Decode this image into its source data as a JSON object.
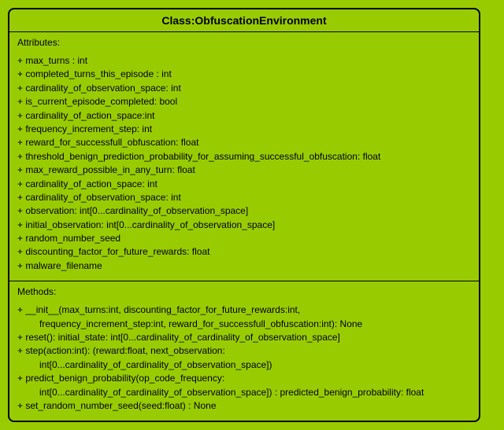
{
  "class_name": "Class:ObfuscationEnvironment",
  "attributes_label": "Attributes:",
  "methods_label": "Methods:",
  "attributes": [
    "+ max_turns : int",
    "+ completed_turns_this_episode : int",
    "+ cardinality_of_observation_space: int",
    "+ is_current_episode_completed: bool",
    "+ cardinality_of_action_space:int",
    "+ frequency_increment_step: int",
    "+ reward_for_successfull_obfuscation: float",
    "+ threshold_benign_prediction_probability_for_assuming_successful_obfuscation: float",
    "+ max_reward_possible_in_any_turn: float",
    "+ cardinality_of_action_space: int",
    "+ cardinality_of_observation_space: int",
    "+ observation: int[0...cardinality_of_observation_space]",
    "+ initial_observation: int[0...cardinality_of_observation_space]",
    "+ random_number_seed",
    "+ discounting_factor_for_future_rewards: float",
    "+ malware_filename"
  ],
  "methods": [
    {
      "line1": "+ __init__(max_turns:int, discounting_factor_for_future_rewards:int,",
      "line2": "frequency_increment_step:int, reward_for_successfull_obfuscation:int): None"
    },
    {
      "line1": "+ reset(): initial_state: int[0...cardinality_of_cardinality_of_observation_space]"
    },
    {
      "line1": "+ step(action:int): (reward:float, next_observation:",
      "line2": "int[0...cardinality_of_cardinality_of_observation_space])"
    },
    {
      "line1": "+ predict_benign_probability(op_code_frequency:",
      "line2": "int[0...cardinality_of_cardinality_of_observation_space]) : predicted_benign_probability: float"
    },
    {
      "line1": "+ set_random_number_seed(seed:float) : None"
    }
  ]
}
